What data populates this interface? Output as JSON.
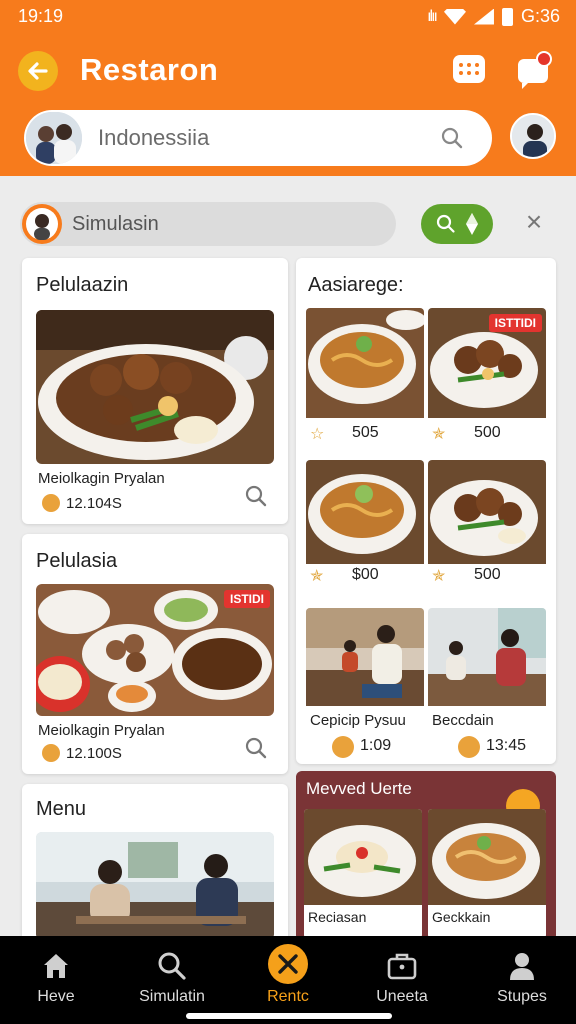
{
  "status": {
    "time": "19:19",
    "right_time": "G:36",
    "vibrate": "ılıı"
  },
  "header": {
    "title": "Restaron",
    "back_icon": "arrow-left-icon",
    "menu_icon": "keyboard-menu-icon",
    "chat_icon": "chat-bubble-icon"
  },
  "search": {
    "value": "Indonessiia",
    "icon": "search-icon"
  },
  "filter": {
    "value": "Simulasin",
    "close": "×"
  },
  "cards": {
    "card1": {
      "title": "Pelulaazin",
      "item_name": "Meiolkagin Pryalan",
      "price": "12.104S"
    },
    "card2": {
      "title": "Pelulasia",
      "badge": "ISTIDI",
      "item_name": "Meiolkagin Pryalan",
      "price": "12.100S"
    },
    "card3": {
      "title": "Menu"
    }
  },
  "grid": {
    "title": "Aasiarege:",
    "badge": "ISTTIDI",
    "tiles": [
      {
        "price": "505"
      },
      {
        "price": "500"
      },
      {
        "price": "$00"
      },
      {
        "price": "500"
      }
    ],
    "people_tiles": [
      {
        "name": "Cepicip Pysuu",
        "time": "1:09"
      },
      {
        "name": "Beccdain",
        "time": "13:45"
      }
    ]
  },
  "special": {
    "title": "Mevved Uerte",
    "items": [
      {
        "name": "Reciasan"
      },
      {
        "name": "Geckkain"
      }
    ]
  },
  "nav": [
    {
      "label": "Heve",
      "icon": "home-icon"
    },
    {
      "label": "Simulatin",
      "icon": "search-icon"
    },
    {
      "label": "Rentc",
      "icon": "close-circle-icon"
    },
    {
      "label": "Uneeta",
      "icon": "briefcase-icon"
    },
    {
      "label": "Stupes",
      "icon": "person-icon"
    }
  ],
  "colors": {
    "primary": "#f77b1c",
    "accent_green": "#5fa32c",
    "nav_active": "#f5a01a",
    "special_bg": "#7a3436"
  }
}
